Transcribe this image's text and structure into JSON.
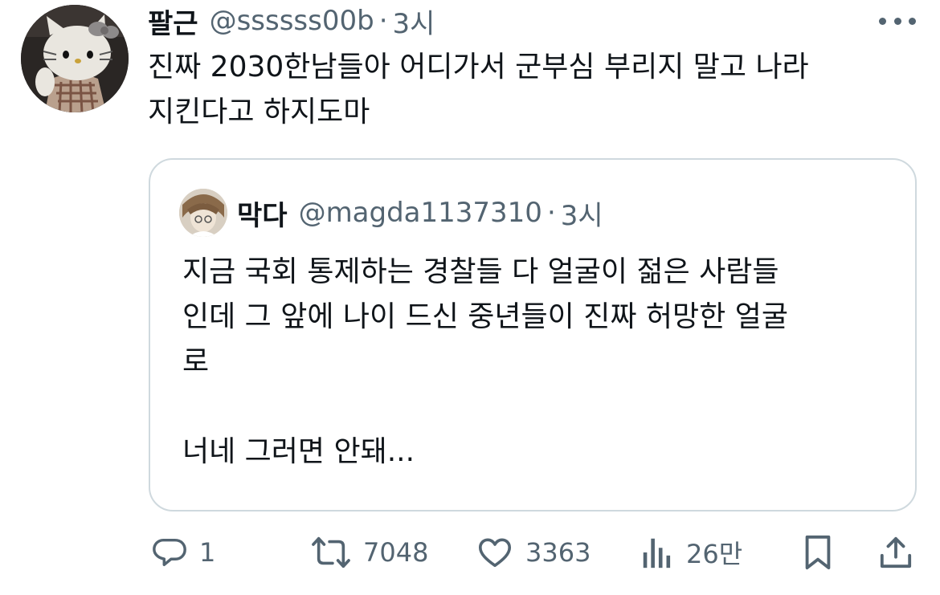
{
  "tweet": {
    "author_name": "팔근",
    "author_handle": "@ssssss00b",
    "separator": "·",
    "time": "3시",
    "text_lines": [
      "진짜 2030한남들아 어디가서 군부심 부리지 말고 나라",
      "지킨다고 하지도마"
    ]
  },
  "quote": {
    "author_name": "막다",
    "author_handle": "@magda1137310",
    "separator": "·",
    "time": "3시",
    "paragraph1_lines": [
      "지금 국회 통제하는 경찰들 다 얼굴이 젊은 사람들",
      "인데 그 앞에 나이 드신 중년들이 진짜 허망한 얼굴",
      "로"
    ],
    "paragraph2": "너네 그러면 안돼..."
  },
  "actions": {
    "reply_count": "1",
    "retweet_count": "7048",
    "like_count": "3363",
    "views_count": "26만"
  },
  "icons": {
    "more": "more-horizontal-icon",
    "reply": "reply-bubble-icon",
    "retweet": "retweet-icon",
    "like": "heart-icon",
    "views": "views-bars-icon",
    "bookmark": "bookmark-icon",
    "share": "share-upload-icon"
  },
  "colors": {
    "text": "#0f1419",
    "secondary": "#536471",
    "border": "#cfd9de"
  }
}
